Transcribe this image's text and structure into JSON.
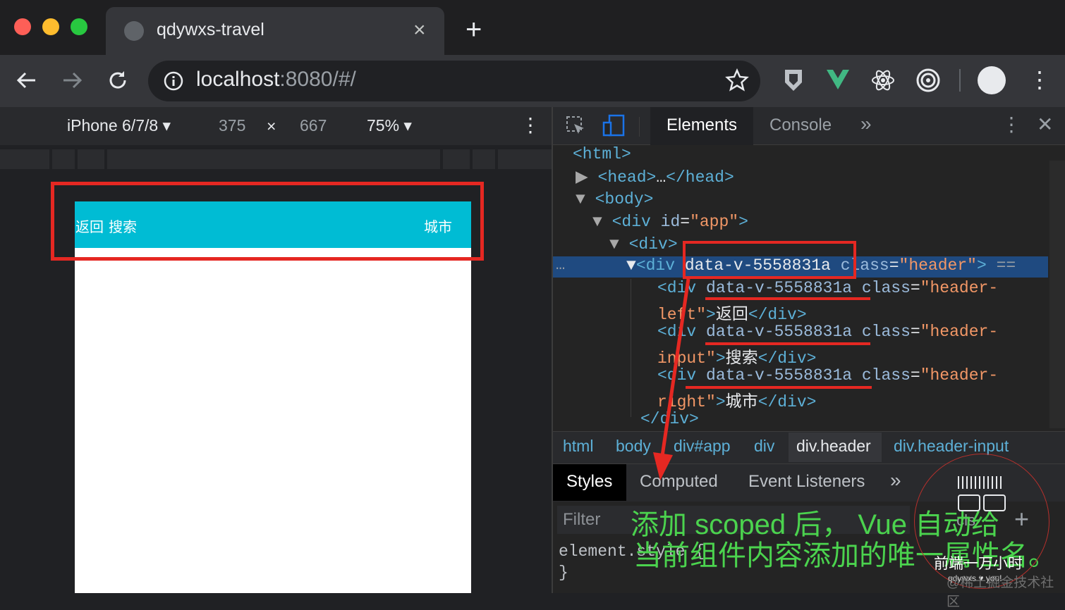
{
  "browser": {
    "tab_title": "qdywxs-travel",
    "tab_close": "×",
    "new_tab": "+",
    "url_host": "localhost",
    "url_rest": ":8080/#/",
    "traffic_colors": [
      "#fe5f57",
      "#febc2e",
      "#28c840"
    ]
  },
  "device_toolbar": {
    "device": "iPhone 6/7/8 ▾",
    "width": "375",
    "times": "×",
    "height": "667",
    "zoom": "75% ▾",
    "menu": "⋮"
  },
  "page": {
    "header_left": "返回",
    "header_input": "搜索",
    "header_right": "城市",
    "header_color": "#00bcd4"
  },
  "devtools": {
    "tabs": [
      "Elements",
      "Console"
    ],
    "more": "»",
    "menu": "⋮",
    "close": "✕",
    "dots": "…",
    "dom": {
      "l1": "<html>",
      "l2_tag": "<head>",
      "l2_ell": "…",
      "l2_end": "</head>",
      "l3": "<body>",
      "l4_tag": "<div ",
      "l4_attr": "id",
      "l4_val": "\"app\"",
      "l4_end": ">",
      "l5": "<div>",
      "sel_open": "<div ",
      "sel_attr1": "data-v-5558831a",
      "sel_attr2": "class",
      "sel_val": "\"header\"",
      "sel_end": ">",
      "sel_eq": "==",
      "c1_open": "<div ",
      "c1_attr1": "data-v-5558831a",
      "c1_attr2": "class",
      "c1_val_a": "\"header-",
      "c1_val_b": "left\"",
      "c1_gt": ">",
      "c1_text": "返回",
      "c1_close": "</div>",
      "c2_open": "<div ",
      "c2_attr1": "data-v-5558831a",
      "c2_attr2": "class",
      "c2_val_a": "\"header-",
      "c2_val_b": "input\"",
      "c2_gt": ">",
      "c2_text": "搜索",
      "c2_close": "</div>",
      "c3_open": "<div ",
      "c3_attr1": "data-v-5558831a",
      "c3_attr2": "class",
      "c3_val_a": "\"header-",
      "c3_val_b": "right\"",
      "c3_gt": ">",
      "c3_text": "城市",
      "c3_close": "</div>",
      "l_end": "</div>"
    },
    "breadcrumbs": [
      "html",
      "body",
      "div#app",
      "div",
      "div.header",
      "div.header-input"
    ],
    "subtabs": [
      "Styles",
      "Computed",
      "Event Listeners"
    ],
    "sub_more": "»",
    "filter_placeholder": "Filter",
    "filter_suffix": ".cls",
    "plus": "+",
    "element_style": "element.style {",
    "close_brace": "}"
  },
  "annotation": {
    "line1": "添加 scoped 后，  Vue 自动给",
    "line2": "当前组件内容添加的唯一属性名。",
    "color": "#4bd34e",
    "highlight_color": "#e52822"
  },
  "watermark": {
    "name": "前端一万小时",
    "sub": "qdywxs ♥ you!",
    "site": "@稀土掘金技术社区"
  }
}
